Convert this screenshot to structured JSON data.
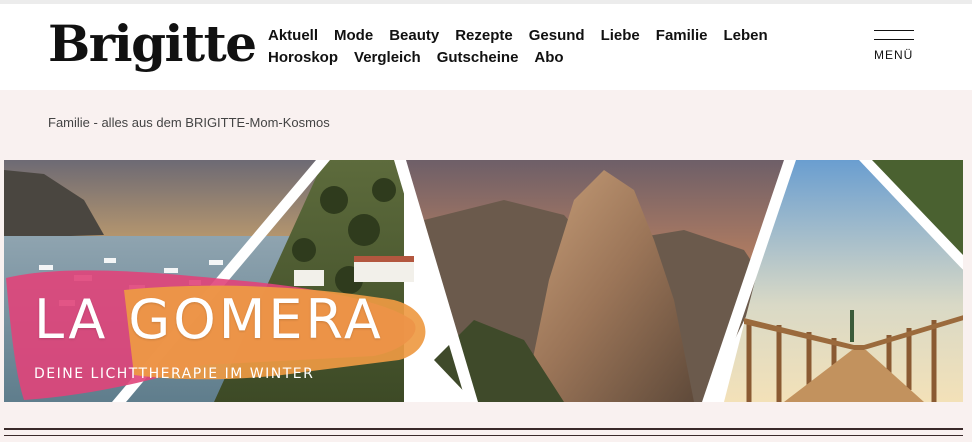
{
  "site": {
    "logo": "Brigitte"
  },
  "nav": {
    "row1": [
      "Aktuell",
      "Mode",
      "Beauty",
      "Rezepte",
      "Gesund",
      "Liebe",
      "Familie",
      "Leben"
    ],
    "row2": [
      "Horoskop",
      "Vergleich",
      "Gutscheine",
      "Abo"
    ]
  },
  "menu": {
    "label": "MENÜ"
  },
  "breadcrumb": {
    "text": "Familie - alles aus dem BRIGITTE-Mom-Kosmos"
  },
  "hero": {
    "title": "LA GOMERA",
    "subtitle": "DEINE LICHTTHERAPIE IM WINTER"
  },
  "colors": {
    "page_bg": "#f9f1f0",
    "brush_pink": "#e0447a",
    "brush_orange": "#ee9a43"
  }
}
